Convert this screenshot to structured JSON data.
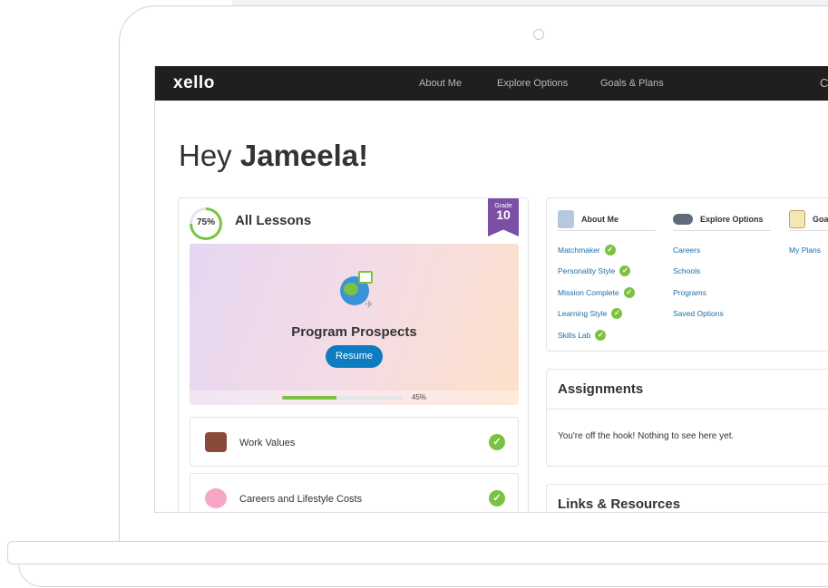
{
  "app": {
    "logo": "xello"
  },
  "nav": {
    "items": [
      "About Me",
      "Explore Options",
      "Goals & Plans"
    ],
    "extra": "C"
  },
  "greeting": {
    "prefix": "Hey ",
    "name": "Jameela!"
  },
  "lessons": {
    "percent_label": "75%",
    "percent_value": 0.75,
    "title": "All Lessons",
    "grade_label": "Grade",
    "grade_number": "10",
    "featured": {
      "title": "Program Prospects",
      "button": "Resume",
      "progress_label": "45%",
      "progress_value": 0.45
    },
    "rows": [
      {
        "label": "Work Values",
        "complete": true
      },
      {
        "label": "Careers and Lifestyle Costs",
        "complete": true
      }
    ]
  },
  "quick_links": {
    "columns": [
      {
        "title": "About Me",
        "icon": "person-figure-icon",
        "items": [
          {
            "label": "Matchmaker",
            "done": true
          },
          {
            "label": "Personality Style",
            "done": true
          },
          {
            "label": "Mission Complete",
            "done": true
          },
          {
            "label": "Learning Style",
            "done": true
          },
          {
            "label": "Skills Lab",
            "done": true
          }
        ]
      },
      {
        "title": "Explore Options",
        "icon": "binoculars-icon",
        "items": [
          {
            "label": "Careers"
          },
          {
            "label": "Schools"
          },
          {
            "label": "Programs"
          },
          {
            "label": "Saved Options"
          }
        ]
      },
      {
        "title": "Goal",
        "icon": "checklist-icon",
        "items": [
          {
            "label": "My Plans"
          }
        ]
      }
    ]
  },
  "assignments": {
    "title": "Assignments",
    "empty_text": "You're off the hook! Nothing to see here yet."
  },
  "links": {
    "title": "Links & Resources"
  },
  "colors": {
    "nav_bg": "#1f1f1f",
    "accent_green": "#7cc242",
    "link_blue": "#1c6ea8",
    "button_blue": "#0e7cc0",
    "grade_purple": "#7b4fa5"
  }
}
